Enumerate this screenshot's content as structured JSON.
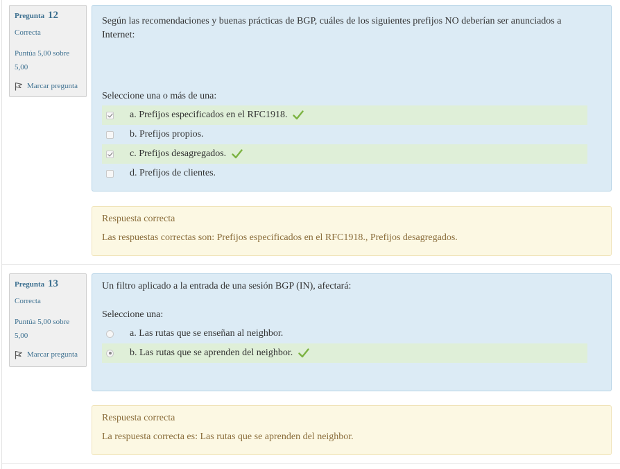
{
  "questions": [
    {
      "info": {
        "label": "Pregunta",
        "number": "12",
        "state": "Correcta",
        "grade": "Puntúa 5,00 sobre 5,00",
        "flag": "Marcar pregunta"
      },
      "text": "Según las recomendaciones y buenas prácticas de BGP, cuáles de los siguientes prefijos NO deberían ser anunciados a Internet:",
      "prompt": "Seleccione una o más de una:",
      "input_type": "checkbox",
      "options": [
        {
          "label": "a. Prefijos especificados en el RFC1918.",
          "checked": true,
          "correct": true,
          "icon": "check-mark-icon"
        },
        {
          "label": "b. Prefijos propios.",
          "checked": false,
          "correct": false
        },
        {
          "label": "c. Prefijos desagregados.",
          "checked": true,
          "correct": true,
          "icon": "check-mark-icon"
        },
        {
          "label": "d. Prefijos de clientes.",
          "checked": false,
          "correct": false
        }
      ],
      "feedback": {
        "title": "Respuesta correcta",
        "text": "Las respuestas correctas son: Prefijos especificados en el RFC1918., Prefijos desagregados."
      }
    },
    {
      "info": {
        "label": "Pregunta",
        "number": "13",
        "state": "Correcta",
        "grade": "Puntúa 5,00 sobre 5,00",
        "flag": "Marcar pregunta"
      },
      "text": "Un filtro aplicado a la entrada de una sesión BGP (IN), afectará:",
      "prompt": "Seleccione una:",
      "input_type": "radio",
      "options": [
        {
          "label": "a. Las rutas que se enseñan al neighbor.",
          "checked": false,
          "correct": false
        },
        {
          "label": "b. Las rutas que se aprenden del neighbor.",
          "checked": true,
          "correct": true,
          "icon": "check-mark-icon"
        }
      ],
      "feedback": {
        "title": "Respuesta correcta",
        "text": "La respuesta correcta es: Las rutas que se aprenden del neighbor."
      }
    }
  ],
  "colors": {
    "formulation_bg": "#dcebf5",
    "outcome_bg": "#fcf8e3",
    "correct_row_bg": "#dfefd8",
    "tick_green": "#7cb342",
    "info_link": "#3d7090"
  }
}
